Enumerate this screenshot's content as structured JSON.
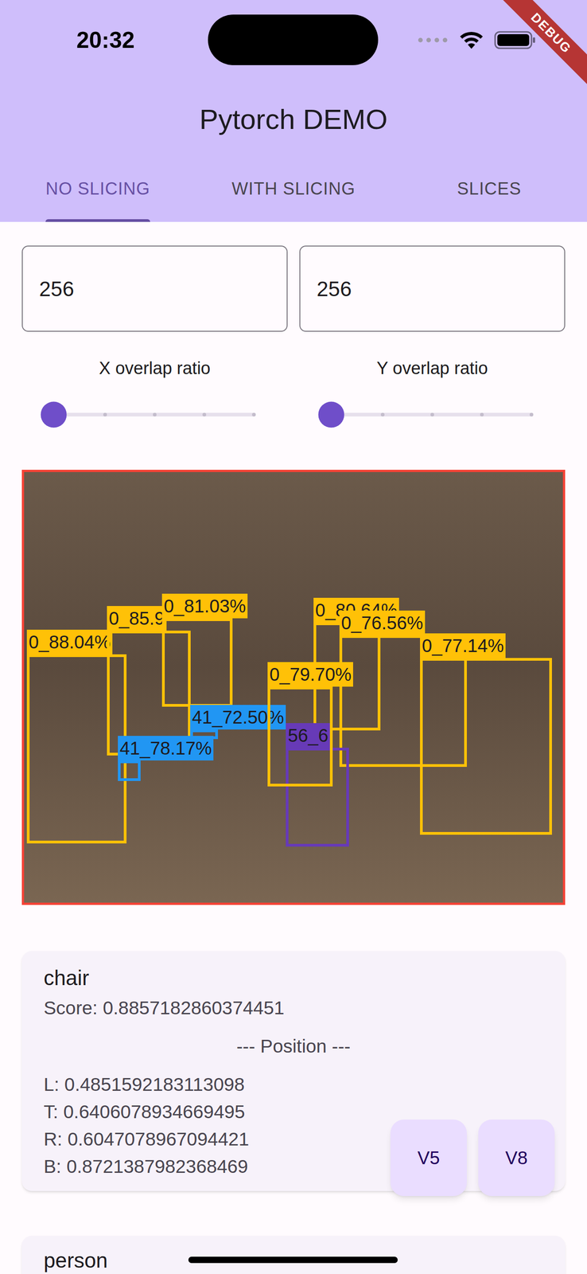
{
  "status_bar": {
    "time": "20:32"
  },
  "debug_banner": "DEBUG",
  "app_bar": {
    "title": "Pytorch DEMO"
  },
  "tabs": [
    {
      "label": "NO SLICING",
      "selected": true
    },
    {
      "label": "WITH SLICING",
      "selected": false
    },
    {
      "label": "SLICES",
      "selected": false
    }
  ],
  "fields": [
    {
      "value": "256"
    },
    {
      "value": "256"
    }
  ],
  "sliders": [
    {
      "label": "X overlap ratio",
      "level": 0
    },
    {
      "label": "Y overlap ratio",
      "level": 0
    }
  ],
  "detections": [
    {
      "label": "0_88.04%",
      "color": "#ffc107",
      "box": [
        0.005,
        0.423,
        0.19,
        0.862
      ]
    },
    {
      "label": "0_85.9",
      "color": "#ffc107",
      "box": [
        0.154,
        0.368,
        0.309,
        0.658
      ]
    },
    {
      "label": "0_81.03%",
      "color": "#ffc107",
      "box": [
        0.256,
        0.34,
        0.387,
        0.545
      ]
    },
    {
      "label": "41_72.50%",
      "color": "#2196f3",
      "box": [
        0.308,
        0.598,
        0.36,
        0.62
      ]
    },
    {
      "label": "41_78.17%",
      "color": "#2196f3",
      "box": [
        0.174,
        0.67,
        0.216,
        0.717
      ]
    },
    {
      "label": "0_80.64%",
      "color": "#ffc107",
      "box": [
        0.537,
        0.349,
        0.661,
        0.6
      ]
    },
    {
      "label": "0_76.56%",
      "color": "#ffc107",
      "box": [
        0.585,
        0.379,
        0.822,
        0.685
      ]
    },
    {
      "label": "56_6",
      "color": "#673ab7",
      "box": [
        0.486,
        0.64,
        0.603,
        0.87
      ]
    },
    {
      "label": "0_79.70%",
      "color": "#ffc107",
      "box": [
        0.452,
        0.498,
        0.573,
        0.73
      ]
    },
    {
      "label": "0_77.14%",
      "color": "#ffc107",
      "box": [
        0.735,
        0.432,
        0.98,
        0.842
      ]
    }
  ],
  "results": [
    {
      "name": "chair",
      "score": "Score: 0.8857182860374451",
      "position_title": "--- Position ---",
      "coords": [
        "L: 0.4851592183113098",
        "T: 0.6406078934669495",
        "R: 0.6047078967094421",
        "B: 0.8721387982368469"
      ]
    },
    {
      "name": "person"
    }
  ],
  "fab_buttons": [
    "V5",
    "V8"
  ]
}
